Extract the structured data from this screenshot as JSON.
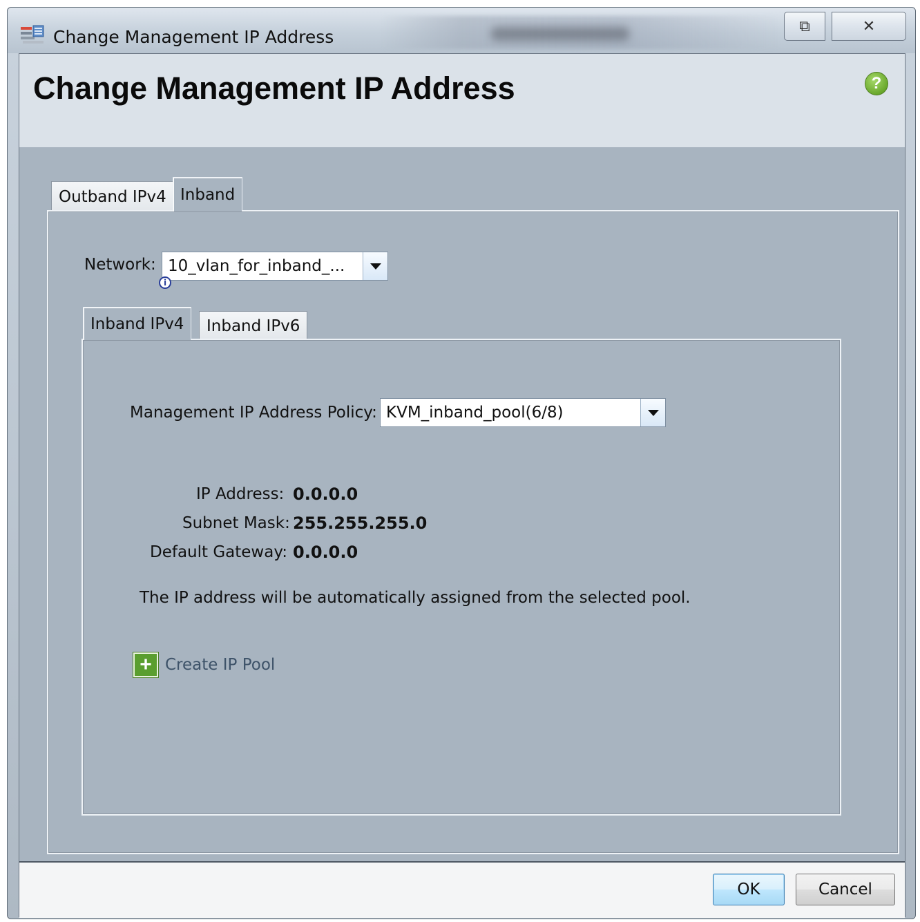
{
  "window": {
    "title": "Change Management IP Address",
    "restore_glyph": "⧉",
    "close_glyph": "✕"
  },
  "header": {
    "title": "Change Management IP Address",
    "help_glyph": "?"
  },
  "tabs": [
    {
      "label": "Outband IPv4",
      "selected": false
    },
    {
      "label": "Inband",
      "selected": true
    }
  ],
  "network": {
    "label": "Network:",
    "value": "10_vlan_for_inband_...",
    "info_glyph": "i"
  },
  "sub_tabs": [
    {
      "label": "Inband IPv4",
      "selected": true
    },
    {
      "label": "Inband IPv6",
      "selected": false
    }
  ],
  "policy": {
    "label": "Management IP Address Policy:",
    "value": "KVM_inband_pool(6/8)"
  },
  "fields": [
    {
      "label": "IP Address:",
      "value": "0.0.0.0"
    },
    {
      "label": "Subnet Mask:",
      "value": "255.255.255.0"
    },
    {
      "label": "Default Gateway:",
      "value": "0.0.0.0"
    }
  ],
  "info_text": "The IP address will be automatically assigned from the selected pool.",
  "create_pool": {
    "label": "Create IP Pool",
    "icon_glyph": "+"
  },
  "footer": {
    "ok_label": "OK",
    "cancel_label": "Cancel"
  },
  "colors": {
    "panel": "#a8b4c0",
    "header_band": "#dbe2e9",
    "accent_green": "#5a9e2f"
  }
}
